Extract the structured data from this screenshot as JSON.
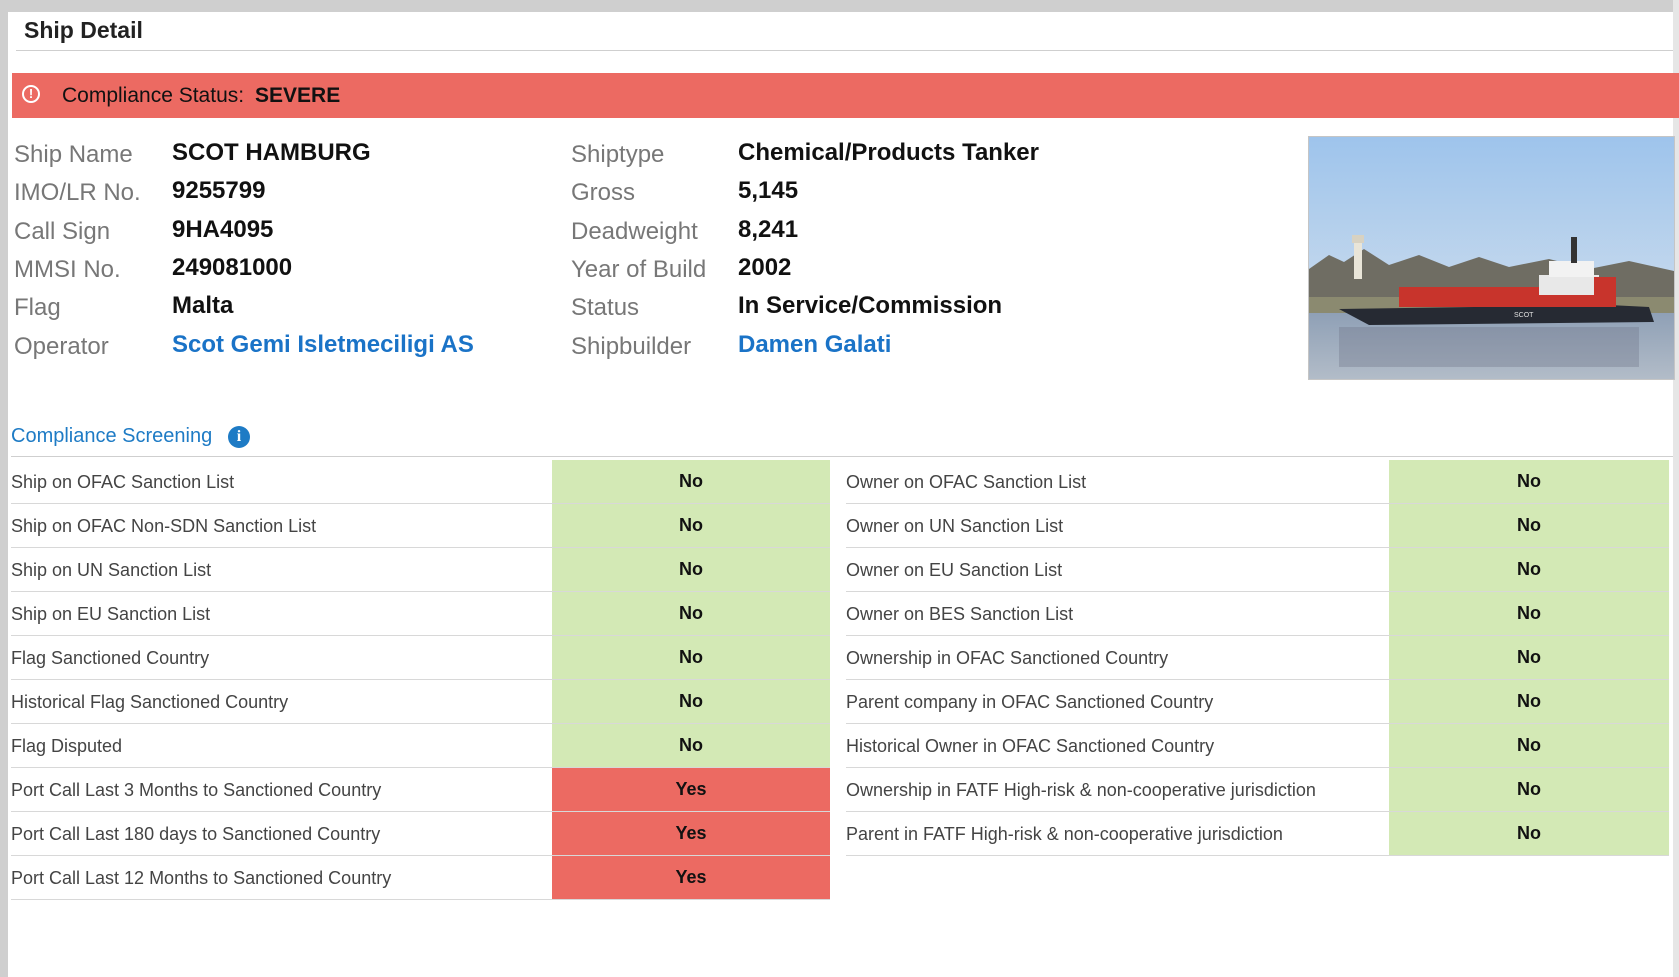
{
  "header": {
    "title": "Ship Detail"
  },
  "status": {
    "label": "Compliance Status:",
    "value": "SEVERE",
    "icon": "alert-circle-icon",
    "color": "#ec6a62"
  },
  "ship_info": {
    "left": [
      {
        "label": "Ship Name",
        "value": "SCOT HAMBURG",
        "link": false
      },
      {
        "label": "IMO/LR No.",
        "value": "9255799",
        "link": false
      },
      {
        "label": "Call Sign",
        "value": "9HA4095",
        "link": false
      },
      {
        "label": "MMSI No.",
        "value": "249081000",
        "link": false
      },
      {
        "label": "Flag",
        "value": "Malta",
        "link": false
      },
      {
        "label": "Operator",
        "value": "Scot Gemi Isletmeciligi AS",
        "link": true
      }
    ],
    "right": [
      {
        "label": "Shiptype",
        "value": "Chemical/Products Tanker",
        "link": false
      },
      {
        "label": "Gross",
        "value": "5,145",
        "link": false
      },
      {
        "label": "Deadweight",
        "value": "8,241",
        "link": false
      },
      {
        "label": "Year of Build",
        "value": "2002",
        "link": false
      },
      {
        "label": "Status",
        "value": "In Service/Commission",
        "link": false
      },
      {
        "label": "Shipbuilder",
        "value": "Damen Galati",
        "link": true
      }
    ],
    "photo_hull_text": "SCOT"
  },
  "screening": {
    "title": "Compliance Screening",
    "info_icon": "info-icon",
    "left": [
      {
        "label": "Ship on OFAC Sanction List",
        "value": "No"
      },
      {
        "label": "Ship on OFAC Non-SDN Sanction List",
        "value": "No"
      },
      {
        "label": "Ship on UN Sanction List",
        "value": "No"
      },
      {
        "label": "Ship on EU Sanction List",
        "value": "No"
      },
      {
        "label": "Flag Sanctioned Country",
        "value": "No"
      },
      {
        "label": "Historical Flag Sanctioned Country",
        "value": "No"
      },
      {
        "label": "Flag Disputed",
        "value": "No"
      },
      {
        "label": "Port Call Last 3 Months to Sanctioned Country",
        "value": "Yes"
      },
      {
        "label": "Port Call Last 180 days to Sanctioned Country",
        "value": "Yes"
      },
      {
        "label": "Port Call Last 12 Months to Sanctioned Country",
        "value": "Yes"
      }
    ],
    "right": [
      {
        "label": "Owner on OFAC Sanction List",
        "value": "No"
      },
      {
        "label": "Owner on UN Sanction List",
        "value": "No"
      },
      {
        "label": "Owner on EU Sanction List",
        "value": "No"
      },
      {
        "label": "Owner on BES Sanction List",
        "value": "No"
      },
      {
        "label": "Ownership in OFAC Sanctioned Country",
        "value": "No"
      },
      {
        "label": "Parent company in OFAC Sanctioned Country",
        "value": "No"
      },
      {
        "label": "Historical Owner in OFAC Sanctioned Country",
        "value": "No"
      },
      {
        "label": "Ownership in FATF High-risk & non-cooperative jurisdiction",
        "value": "No"
      },
      {
        "label": "Parent in FATF High-risk & non-cooperative jurisdiction",
        "value": "No"
      }
    ],
    "colors": {
      "no": "#d3e9b5",
      "yes": "#ec6a62"
    }
  }
}
